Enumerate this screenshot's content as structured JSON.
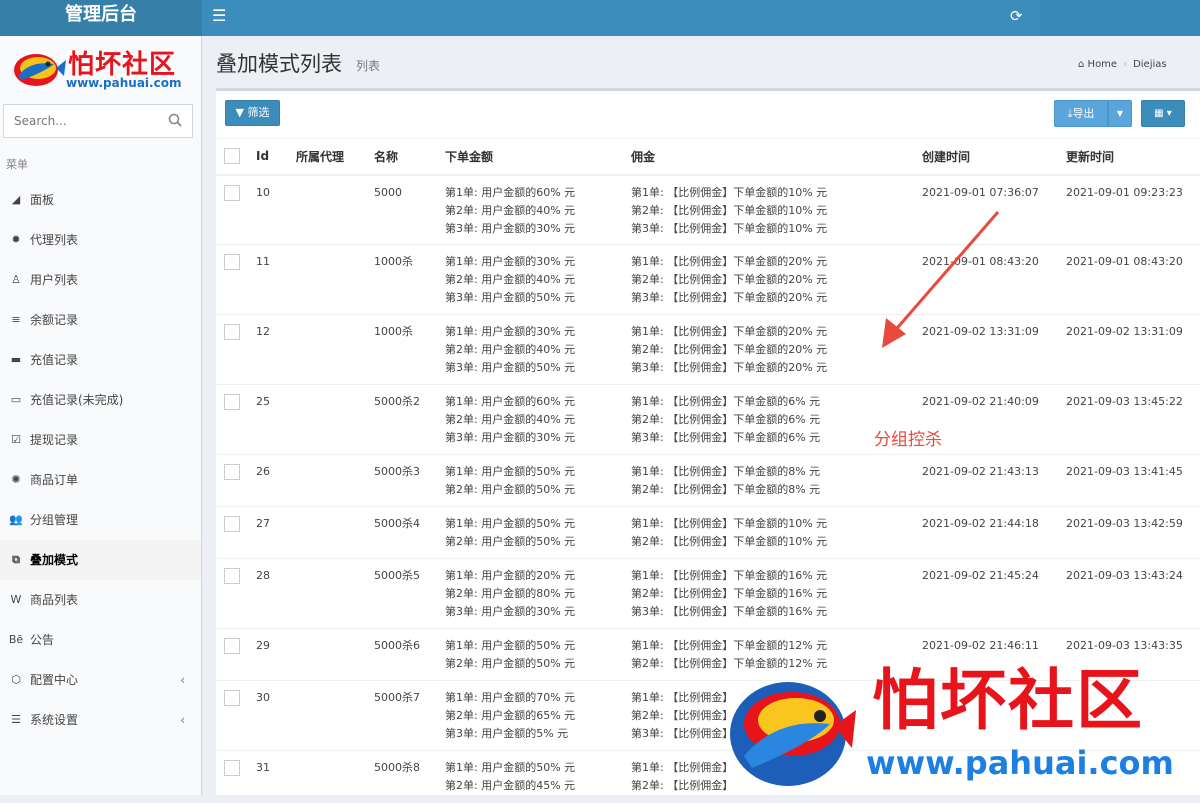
{
  "header": {
    "brand": "管理后台",
    "menu_icon": "menu-icon",
    "refresh_icon": "refresh-icon"
  },
  "sidebar": {
    "logo_text": "怕坏社区",
    "logo_url": "www.pahuai.com",
    "search_placeholder": "Search...",
    "menu_header": "菜单",
    "items": [
      {
        "label": "面板",
        "icon": "chart-area-icon",
        "glyph": "◢"
      },
      {
        "label": "代理列表",
        "icon": "gear-icon",
        "glyph": "✹"
      },
      {
        "label": "用户列表",
        "icon": "user-icon",
        "glyph": "♙"
      },
      {
        "label": "余额记录",
        "icon": "list-icon",
        "glyph": "≡"
      },
      {
        "label": "充值记录",
        "icon": "credit-card-icon",
        "glyph": "▬"
      },
      {
        "label": "充值记录(未完成)",
        "icon": "card-outline-icon",
        "glyph": "▭"
      },
      {
        "label": "提现记录",
        "icon": "check-square-icon",
        "glyph": "☑"
      },
      {
        "label": "商品订单",
        "icon": "cog-icon",
        "glyph": "✺"
      },
      {
        "label": "分组管理",
        "icon": "users-icon",
        "glyph": "👥"
      },
      {
        "label": "叠加模式",
        "icon": "object-group-icon",
        "glyph": "⧉",
        "active": true
      },
      {
        "label": "商品列表",
        "icon": "w-icon",
        "glyph": "W"
      },
      {
        "label": "公告",
        "icon": "behance-icon",
        "glyph": "Bē"
      },
      {
        "label": "配置中心",
        "icon": "hexagon-icon",
        "glyph": "⬡",
        "chevron": "‹"
      },
      {
        "label": "系统设置",
        "icon": "list-alt-icon",
        "glyph": "☰",
        "chevron": "‹"
      }
    ]
  },
  "page": {
    "title": "叠加模式列表",
    "subtitle": "列表",
    "breadcrumb": [
      "Home",
      "Diejias"
    ]
  },
  "toolbar": {
    "filter_label": "筛选",
    "export_label": "导出"
  },
  "table": {
    "columns": [
      "Id",
      "所属代理",
      "名称",
      "下单金额",
      "佣金",
      "创建时间",
      "更新时间"
    ],
    "rows": [
      {
        "id": "10",
        "agent": "",
        "name": "5000",
        "amount": [
          "第1单: 用户金额的60% 元",
          "第2单: 用户金额的40% 元",
          "第3单: 用户金额的30% 元"
        ],
        "commission": [
          "第1单: 【比例佣金】下单金额的10% 元",
          "第2单: 【比例佣金】下单金额的10% 元",
          "第3单: 【比例佣金】下单金额的10% 元"
        ],
        "created": "2021-09-01 07:36:07",
        "updated": "2021-09-01 09:23:23"
      },
      {
        "id": "11",
        "agent": "",
        "name": "1000杀",
        "amount": [
          "第1单: 用户金额的30% 元",
          "第2单: 用户金额的40% 元",
          "第3单: 用户金额的50% 元"
        ],
        "commission": [
          "第1单: 【比例佣金】下单金额的20% 元",
          "第2单: 【比例佣金】下单金额的20% 元",
          "第3单: 【比例佣金】下单金额的20% 元"
        ],
        "created": "2021-09-01 08:43:20",
        "updated": "2021-09-01 08:43:20"
      },
      {
        "id": "12",
        "agent": "",
        "name": "1000杀",
        "amount": [
          "第1单: 用户金额的30% 元",
          "第2单: 用户金额的40% 元",
          "第3单: 用户金额的50% 元"
        ],
        "commission": [
          "第1单: 【比例佣金】下单金额的20% 元",
          "第2单: 【比例佣金】下单金额的20% 元",
          "第3单: 【比例佣金】下单金额的20% 元"
        ],
        "created": "2021-09-02 13:31:09",
        "updated": "2021-09-02 13:31:09"
      },
      {
        "id": "25",
        "agent": "",
        "name": "5000杀2",
        "amount": [
          "第1单: 用户金额的60% 元",
          "第2单: 用户金额的40% 元",
          "第3单: 用户金额的30% 元"
        ],
        "commission": [
          "第1单: 【比例佣金】下单金额的6% 元",
          "第2单: 【比例佣金】下单金额的6% 元",
          "第3单: 【比例佣金】下单金额的6% 元"
        ],
        "created": "2021-09-02 21:40:09",
        "updated": "2021-09-03 13:45:22"
      },
      {
        "id": "26",
        "agent": "",
        "name": "5000杀3",
        "amount": [
          "第1单: 用户金额的50% 元",
          "第2单: 用户金额的50% 元"
        ],
        "commission": [
          "第1单: 【比例佣金】下单金额的8% 元",
          "第2单: 【比例佣金】下单金额的8% 元"
        ],
        "created": "2021-09-02 21:43:13",
        "updated": "2021-09-03 13:41:45"
      },
      {
        "id": "27",
        "agent": "",
        "name": "5000杀4",
        "amount": [
          "第1单: 用户金额的50% 元",
          "第2单: 用户金额的50% 元"
        ],
        "commission": [
          "第1单: 【比例佣金】下单金额的10% 元",
          "第2单: 【比例佣金】下单金额的10% 元"
        ],
        "created": "2021-09-02 21:44:18",
        "updated": "2021-09-03 13:42:59"
      },
      {
        "id": "28",
        "agent": "",
        "name": "5000杀5",
        "amount": [
          "第1单: 用户金额的20% 元",
          "第2单: 用户金额的80% 元",
          "第3单: 用户金额的30% 元"
        ],
        "commission": [
          "第1单: 【比例佣金】下单金额的16% 元",
          "第2单: 【比例佣金】下单金额的16% 元",
          "第3单: 【比例佣金】下单金额的16% 元"
        ],
        "created": "2021-09-02 21:45:24",
        "updated": "2021-09-03 13:43:24"
      },
      {
        "id": "29",
        "agent": "",
        "name": "5000杀6",
        "amount": [
          "第1单: 用户金额的50% 元",
          "第2单: 用户金额的50% 元"
        ],
        "commission": [
          "第1单: 【比例佣金】下单金额的12% 元",
          "第2单: 【比例佣金】下单金额的12% 元"
        ],
        "created": "2021-09-02 21:46:11",
        "updated": "2021-09-03 13:43:35"
      },
      {
        "id": "30",
        "agent": "",
        "name": "5000杀7",
        "amount": [
          "第1单: 用户金额的70% 元",
          "第2单: 用户金额的65% 元",
          "第3单: 用户金额的5% 元"
        ],
        "commission": [
          "第1单: 【比例佣金】",
          "第2单: 【比例佣金】",
          "第3单: 【比例佣金】"
        ],
        "created": "",
        "updated": ""
      },
      {
        "id": "31",
        "agent": "",
        "name": "5000杀8",
        "amount": [
          "第1单: 用户金额的50% 元",
          "第2单: 用户金额的45% 元"
        ],
        "commission": [
          "第1单: 【比例佣金】",
          "第2单: 【比例佣金】"
        ],
        "created": "",
        "updated": ""
      }
    ]
  },
  "annotation": {
    "text": "分组控杀",
    "color": "#e84a3c"
  },
  "watermark": {
    "text": "怕坏社区",
    "url": "www.pahuai.com"
  },
  "colors": {
    "primary": "#3c8dbc",
    "header_dark": "#367fa9",
    "export": "#5aa5db",
    "logo_red": "#e8141c",
    "logo_blue": "#1a6fc4"
  }
}
